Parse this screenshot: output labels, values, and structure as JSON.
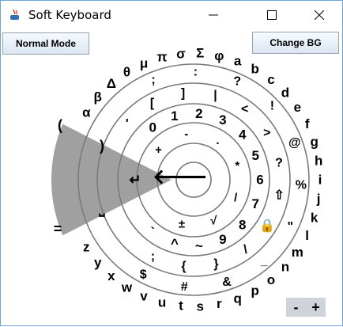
{
  "window": {
    "title": "Soft Keyboard"
  },
  "toolbar": {
    "normal_mode_label": "Normal Mode",
    "change_bg_label": "Change BG"
  },
  "zoom": {
    "minus_label": "-",
    "plus_label": "+"
  },
  "colors": {
    "sector": "#a0a0a0",
    "rings": "#7a7a7a",
    "button_bg": "#dbe6f1",
    "frame": "#6fa3d8"
  },
  "keys": {
    "outer": [
      "α",
      "β",
      "Δ",
      "θ",
      "μ",
      "π",
      "σ",
      "Σ",
      "φ",
      "a",
      "b",
      "c",
      "d",
      "e",
      "f",
      "g",
      "h",
      "i",
      "j",
      "k",
      "l",
      "m",
      "n",
      "o",
      "p",
      "q",
      "r",
      "s",
      "t",
      "u",
      "v",
      "w",
      "x",
      "y",
      "z"
    ],
    "ring3": [
      ";",
      ":",
      "?",
      "!",
      "@",
      "%",
      "\"",
      "_",
      "&",
      "#",
      "$"
    ],
    "ring2": [
      "'",
      "[",
      "]",
      "|",
      "<",
      ">",
      "?",
      "⇧",
      "🔒",
      "\\",
      "}",
      "{",
      ";"
    ],
    "ring1": [
      "0",
      "1",
      "2",
      "3",
      "4",
      "5",
      "6",
      "7",
      "8",
      "9",
      "~",
      "^",
      "`"
    ],
    "inner": [
      "+",
      "-",
      ".",
      "*",
      "/",
      "√",
      "±"
    ],
    "center": [
      "↵",
      "🡐",
      "⎵",
      "(",
      ")",
      "="
    ]
  }
}
